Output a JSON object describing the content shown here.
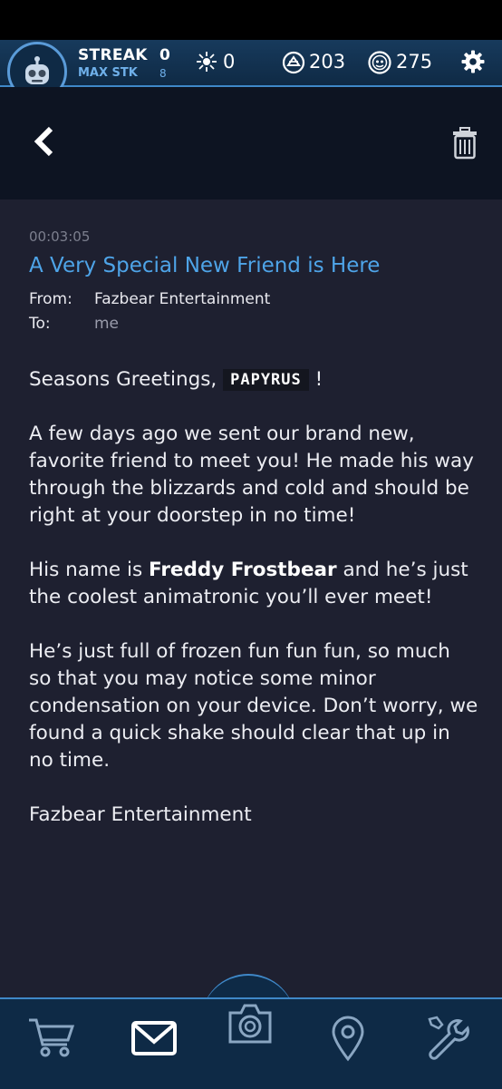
{
  "header": {
    "streak_label": "STREAK",
    "streak_value": "0",
    "max_streak_label": "MAX STK",
    "max_streak_value": "8",
    "stat_1_value": "0",
    "stat_2_value": "203",
    "stat_3_value": "275"
  },
  "mail": {
    "timestamp": "00:03:05",
    "subject": "A Very Special New Friend is Here",
    "from_label": "From:",
    "from_value": "Fazbear Entertainment",
    "to_label": "To:",
    "to_value": "me",
    "greeting_prefix": "Seasons Greetings,",
    "greeting_name": "PAPYRUS",
    "greeting_suffix": "!",
    "p1": "A few days ago we sent our brand new, favorite friend to meet you! He made his way through the blizzards and cold and should be right at your doorstep in no time!",
    "p2_prefix": "His name is",
    "p2_name": "Freddy Frostbear",
    "p2_suffix": "and he’s just the coolest animatronic you’ll ever meet!",
    "p3": "He’s just full of frozen fun fun fun, so much so that you may notice some minor condensation on your device. Don’t worry, we found a quick shake should clear that up in no time.",
    "signature": "Fazbear Entertainment"
  },
  "icons": {
    "avatar": "robot-avatar-icon",
    "stat_1": "spark-icon",
    "stat_2": "parts-icon",
    "stat_3": "faz-token-icon",
    "settings": "gear-icon",
    "back": "back-chevron-icon",
    "delete": "trash-icon",
    "nav": [
      "cart-icon",
      "mail-icon",
      "camera-icon",
      "map-pin-icon",
      "wrench-icon"
    ]
  },
  "colors": {
    "accent": "#4ea4e8",
    "topbar": "#0f2a45",
    "background": "#1e2030"
  }
}
